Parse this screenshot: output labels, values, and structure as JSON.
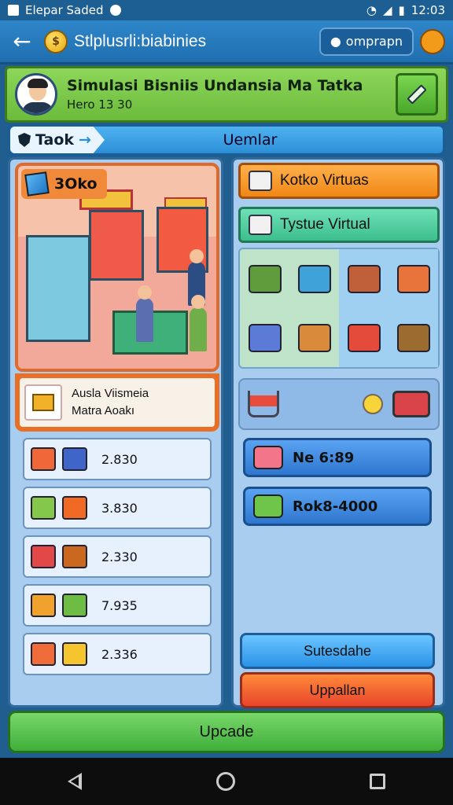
{
  "status_bar": {
    "carrier": "Elepar Saded",
    "time": "12:03"
  },
  "app_bar": {
    "coin_glyph": "$",
    "title": "Stlplusrli:biabinies",
    "login_label": "omprapn"
  },
  "profile": {
    "name": "Simulasi Bisniis Undansia Ma Tatka",
    "subtitle": "Hero 13 30"
  },
  "tabs": {
    "active": "Taok",
    "title": "Uemlar"
  },
  "shop": {
    "badge": "3Oko",
    "info_line1": "Ausla Viismeia",
    "info_line2": "Matra Aoakı"
  },
  "left_items": [
    {
      "value": "2.830",
      "colors": [
        "#f0683a",
        "#3f65c9"
      ]
    },
    {
      "value": "3.830",
      "colors": [
        "#84c74a",
        "#f06a25"
      ]
    },
    {
      "value": "2.330",
      "colors": [
        "#e34848",
        "#c9681e"
      ]
    },
    {
      "value": "7.935",
      "colors": [
        "#f0a22c",
        "#6dbd45"
      ]
    },
    {
      "value": "2.336",
      "colors": [
        "#ef6c3a",
        "#f5c52f"
      ]
    }
  ],
  "right_panel": {
    "btn_virtual": "Kotko Virtuas",
    "btn_tystue": "Tystue Virtual",
    "price1": "Ne 6:89",
    "price2": "Rok8-4000",
    "btn_sutesdahe": "Sutesdahe",
    "btn_uppallan": "Uppallan"
  },
  "grid_icons": [
    "#5f9c3b",
    "#3fa2d8",
    "#c0603a",
    "#e8733b",
    "#5b7bd6",
    "#d98b3b",
    "#e44b3b",
    "#9b6b2f"
  ],
  "upgrade_label": "Upcade"
}
